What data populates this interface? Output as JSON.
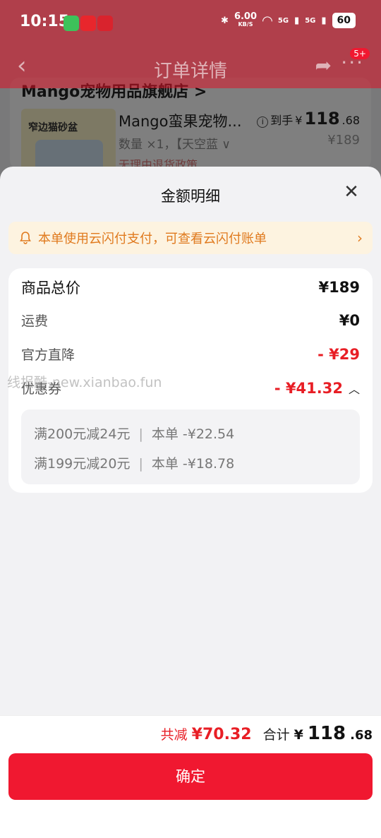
{
  "status_bar": {
    "time": "10:15",
    "network_speed": "6.00",
    "network_unit": "KB/S",
    "signal1": "5G",
    "signal2": "5G",
    "battery": "60"
  },
  "nav": {
    "title": "订单详情",
    "badge": "5+"
  },
  "order": {
    "shop_name": "Mango宠物用品旗舰店 >",
    "image_label": "窄边猫砂盆",
    "product_title": "Mango蛮果宠物...",
    "quantity": "数量 ×1，【天空蓝 ∨",
    "policy": "无理由退货政策",
    "price_label": "到手",
    "price_currency": "¥",
    "price_int": "118",
    "price_dec": ".68",
    "original_price": "¥189"
  },
  "sheet": {
    "title": "金额明细",
    "notice": "本单使用云闪付支付，可查看云闪付账单",
    "rows": [
      {
        "label": "商品总价",
        "value": "¥189"
      },
      {
        "label": "运费",
        "value": "¥0"
      },
      {
        "label": "官方直降",
        "value": "- ¥29"
      },
      {
        "label": "优惠券",
        "value": "- ¥41.32"
      }
    ],
    "coupons": [
      {
        "rule": "满200元减24元",
        "amount": "本单 -¥22.54"
      },
      {
        "rule": "满199元减20元",
        "amount": "本单 -¥18.78"
      }
    ]
  },
  "footer": {
    "cut_label": "共减",
    "cut_value": "¥70.32",
    "total_label": "合计",
    "total_currency": "¥",
    "total_int": "118",
    "total_dec": ".68",
    "confirm": "确定"
  },
  "watermark": "线报酷-new.xianbao.fun",
  "colors": {
    "accent": "#f01830",
    "discount": "#e81e25",
    "notice_text": "#e07a1e",
    "notice_bg": "#fdf3e0"
  }
}
